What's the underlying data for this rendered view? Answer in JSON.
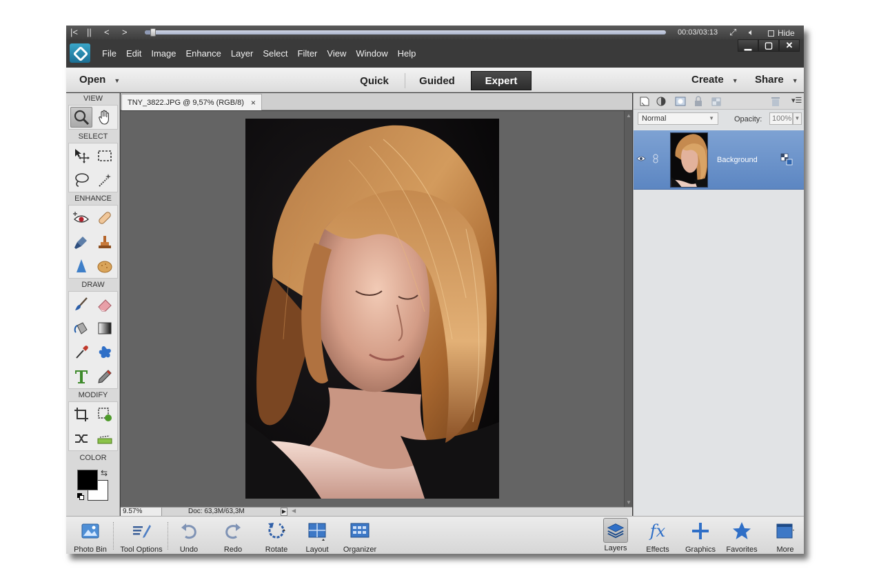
{
  "player": {
    "time": "00:03/03:13",
    "hide_label": "Hide",
    "progress": 0.016
  },
  "menubar": {
    "items": [
      "File",
      "Edit",
      "Image",
      "Enhance",
      "Layer",
      "Select",
      "Filter",
      "View",
      "Window",
      "Help"
    ]
  },
  "modebar": {
    "open_label": "Open",
    "modes": [
      "Quick",
      "Guided",
      "Expert"
    ],
    "active_mode": "Expert",
    "create_label": "Create",
    "share_label": "Share"
  },
  "toolbox": {
    "sections": [
      "VIEW",
      "SELECT",
      "ENHANCE",
      "DRAW",
      "MODIFY",
      "COLOR"
    ],
    "foreground_color": "#000000",
    "background_color": "#ffffff"
  },
  "document": {
    "tab_title": "TNY_3822.JPG @ 9,57% (RGB/8)",
    "tab_close": "×",
    "zoom": "9.57%",
    "doc_info": "Doc: 63,3M/63,3M"
  },
  "layers": {
    "blend_mode": "Normal",
    "opacity_label": "Opacity:",
    "opacity_value": "100%",
    "layer_name": "Background",
    "selected_color": "#6e94cb"
  },
  "taskbar": {
    "photo_bin": "Photo Bin",
    "tool_options": "Tool Options",
    "undo": "Undo",
    "redo": "Redo",
    "rotate": "Rotate",
    "layout": "Layout",
    "organizer": "Organizer",
    "layers": "Layers",
    "effects": "Effects",
    "effects_glyph": "fx",
    "graphics": "Graphics",
    "favorites": "Favorites",
    "more": "More"
  }
}
